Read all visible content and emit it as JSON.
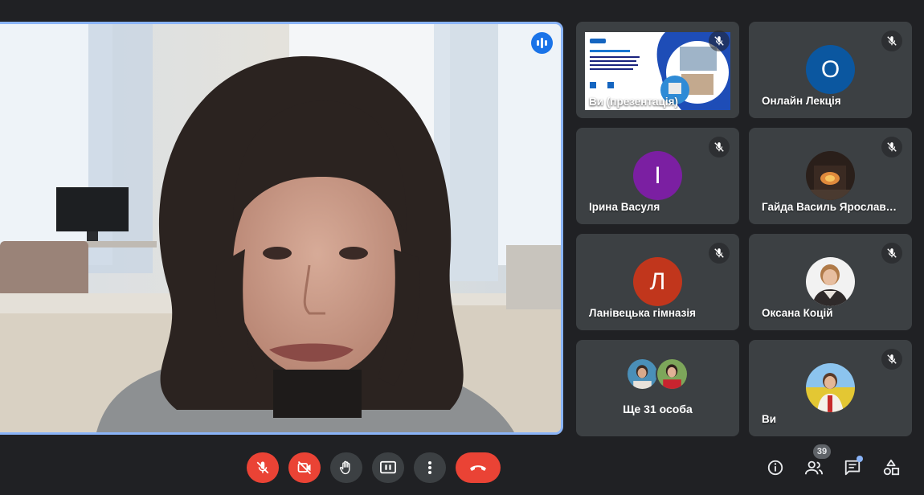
{
  "presentation": {
    "label": "Ви (презентація)"
  },
  "participants": [
    {
      "name": "Онлайн Лекція",
      "initial": "О",
      "color": "#0b57a0"
    },
    {
      "name": "Ірина Васуля",
      "initial": "І",
      "color": "#7b1fa2"
    },
    {
      "name": "Гайда Василь Ярославович",
      "initial": "",
      "color": ""
    },
    {
      "name": "Ланівецька гімназія",
      "initial": "Л",
      "color": "#c1361c"
    },
    {
      "name": "Оксана Коцій",
      "initial": "",
      "color": ""
    },
    {
      "name": "Ви",
      "initial": "",
      "color": ""
    }
  ],
  "others": {
    "label": "Ще 31 особа"
  },
  "people_count": "39",
  "colors": {
    "accent": "#8ab4f8",
    "danger": "#ea4335",
    "control": "#3c4043"
  },
  "controls": {
    "mic": "mic-off-icon",
    "camera": "camera-off-icon",
    "hand": "raise-hand-icon",
    "present": "present-screen-icon",
    "more": "more-vert-icon",
    "leave": "call-end-icon"
  }
}
